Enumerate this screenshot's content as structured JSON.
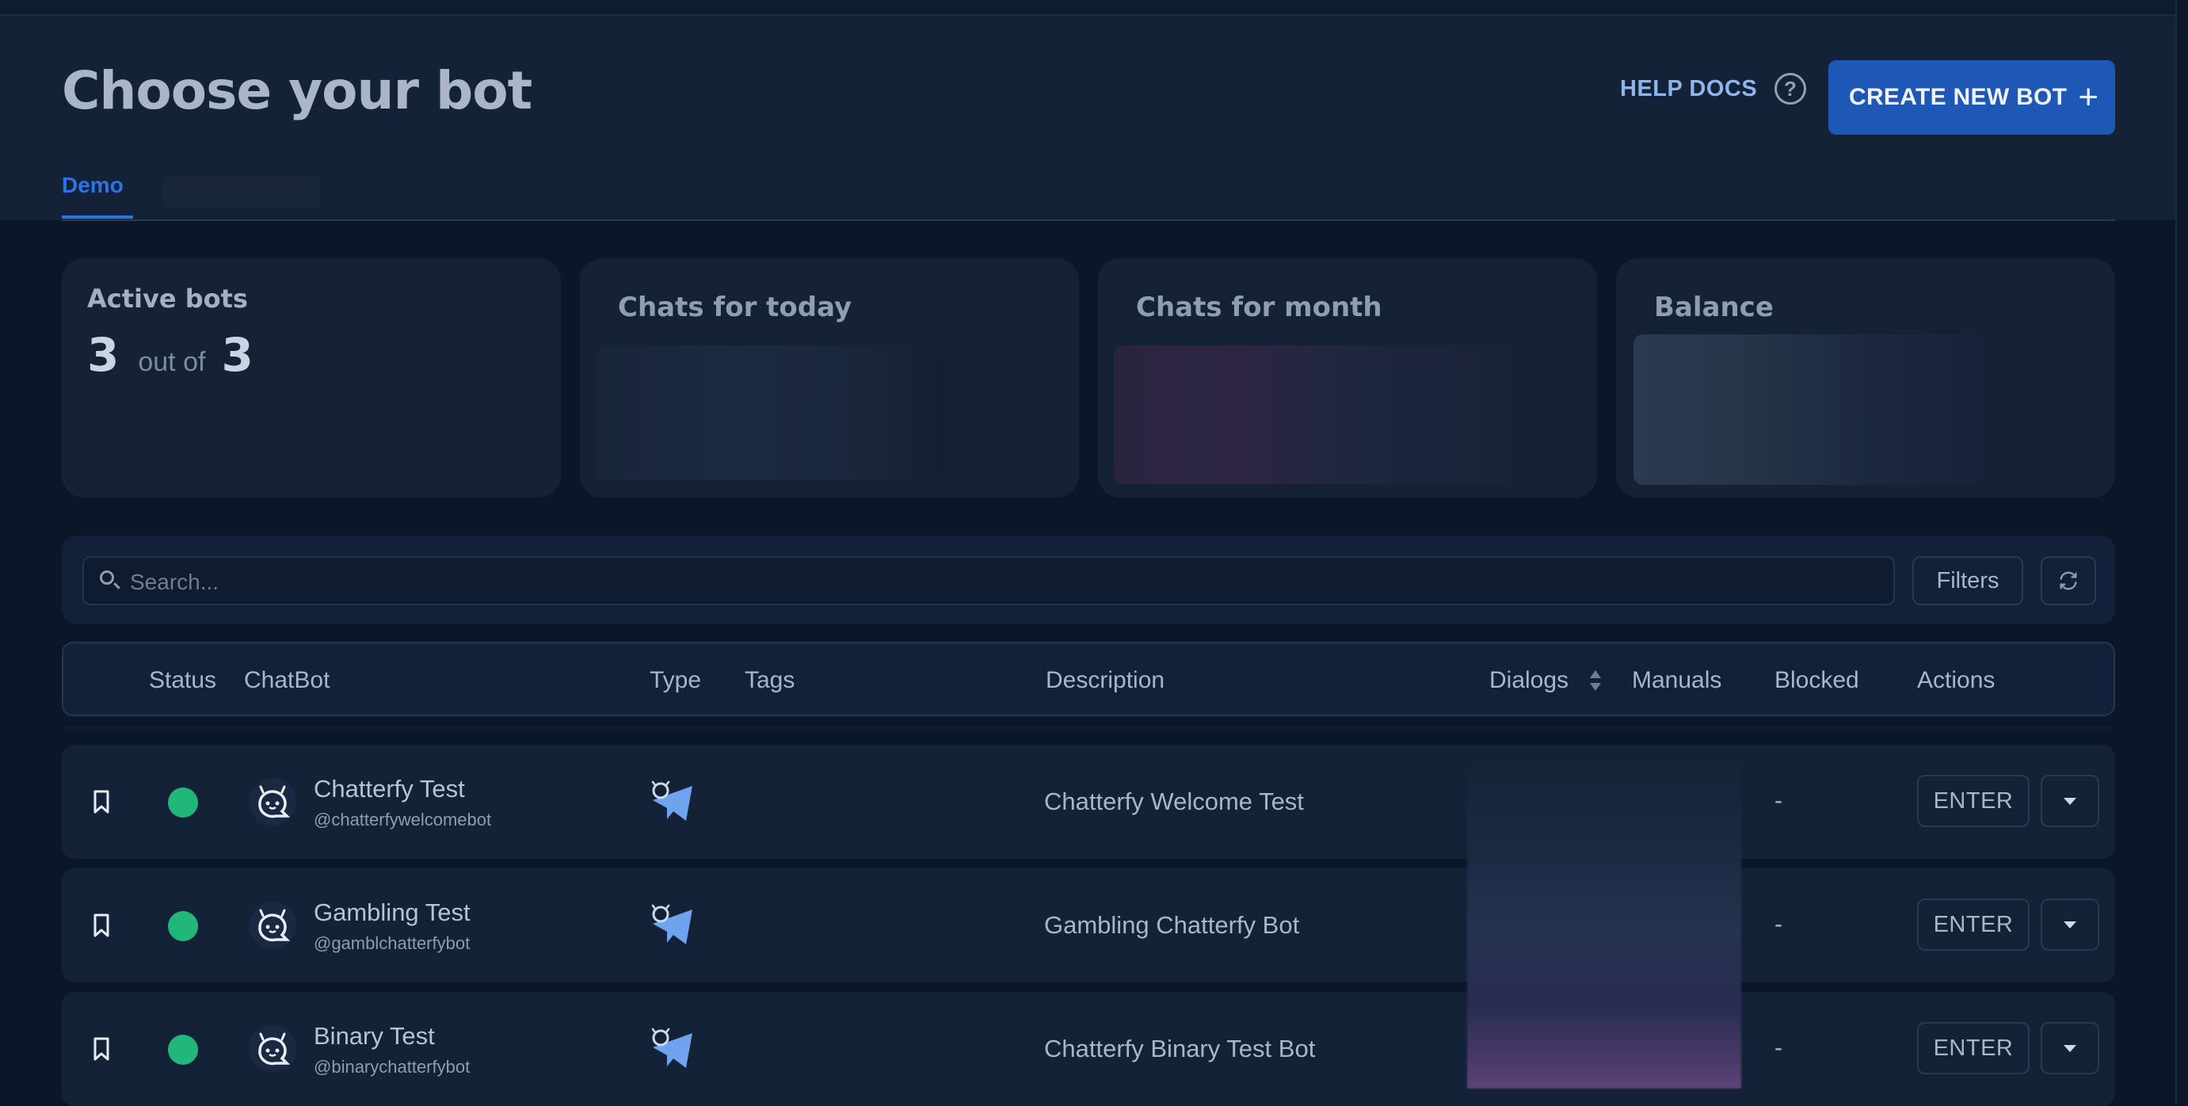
{
  "header": {
    "title": "Choose your bot",
    "help_label": "HELP DOCS",
    "help_icon": "question-circle-icon",
    "create_label": "CREATE NEW BOT",
    "create_icon": "plus-icon",
    "tabs": [
      {
        "label": "Demo",
        "active": true
      }
    ]
  },
  "stats": {
    "active": {
      "title": "Active bots",
      "count": "3",
      "separator": "out of",
      "total": "3"
    },
    "today": {
      "title": "Chats for today"
    },
    "month": {
      "title": "Chats for month"
    },
    "balance": {
      "title": "Balance"
    }
  },
  "search": {
    "placeholder": "Search...",
    "value": "",
    "filters_label": "Filters"
  },
  "table": {
    "columns": [
      "Status",
      "ChatBot",
      "Type",
      "Tags",
      "Description",
      "Dialogs",
      "Manuals",
      "Blocked",
      "Actions"
    ],
    "rows": [
      {
        "name": "Chatterfy Test",
        "handle": "@chatterfywelcomebot",
        "description": "Chatterfy Welcome Test",
        "blocked": "-",
        "action": "ENTER",
        "status": "active"
      },
      {
        "name": "Gambling Test",
        "handle": "@gamblchatterfybot",
        "description": "Gambling Chatterfy Bot",
        "blocked": "-",
        "action": "ENTER",
        "status": "active"
      },
      {
        "name": "Binary Test",
        "handle": "@binarychatterfybot",
        "description": "Chatterfy Binary Test Bot",
        "blocked": "-",
        "action": "ENTER",
        "status": "active"
      }
    ]
  },
  "colors": {
    "accent": "#1f57b7",
    "status_active": "#22b77a",
    "tab_active": "#2c73e6"
  }
}
